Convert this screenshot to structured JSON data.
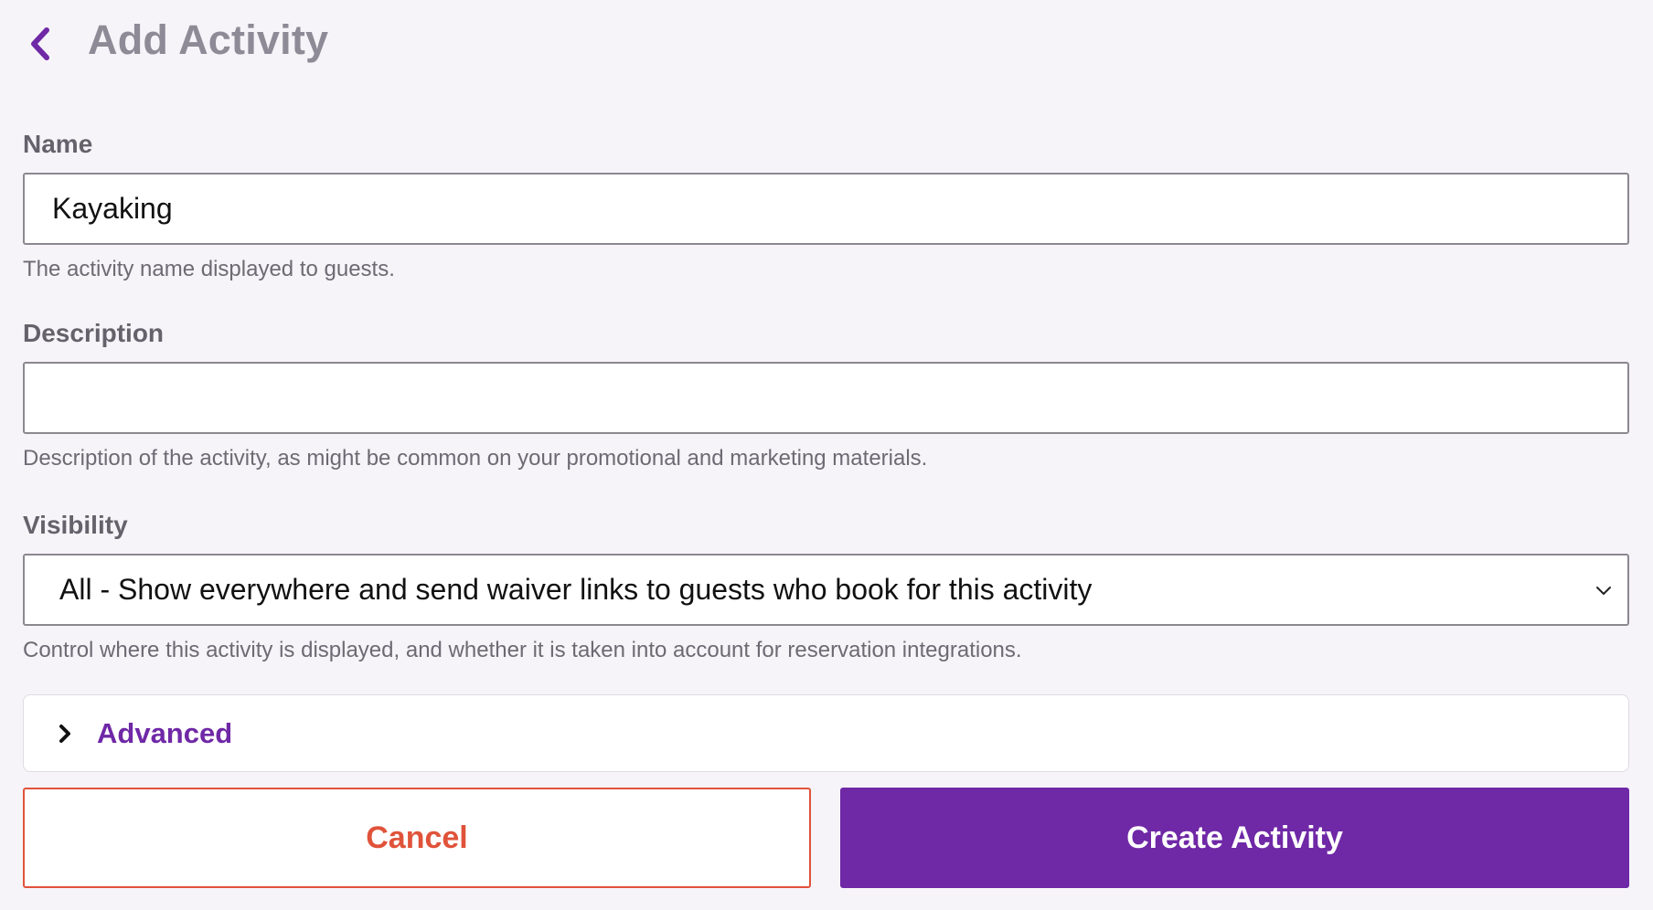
{
  "header": {
    "title": "Add Activity",
    "back_icon": "chevron-left-icon"
  },
  "form": {
    "name": {
      "label": "Name",
      "value": "Kayaking",
      "help": "The activity name displayed to guests."
    },
    "description": {
      "label": "Description",
      "value": "",
      "help": "Description of the activity, as might be common on your promotional and marketing materials."
    },
    "visibility": {
      "label": "Visibility",
      "selected": "All - Show everywhere and send waiver links to guests who book for this activity",
      "help": "Control where this activity is displayed, and whether it is taken into account for reservation integrations."
    },
    "advanced": {
      "label": "Advanced",
      "expanded": false
    }
  },
  "actions": {
    "cancel_label": "Cancel",
    "create_label": "Create Activity"
  },
  "colors": {
    "accent": "#6f28a6",
    "danger": "#e0533a",
    "background": "#f6f4f9",
    "title": "#8e8a96"
  }
}
